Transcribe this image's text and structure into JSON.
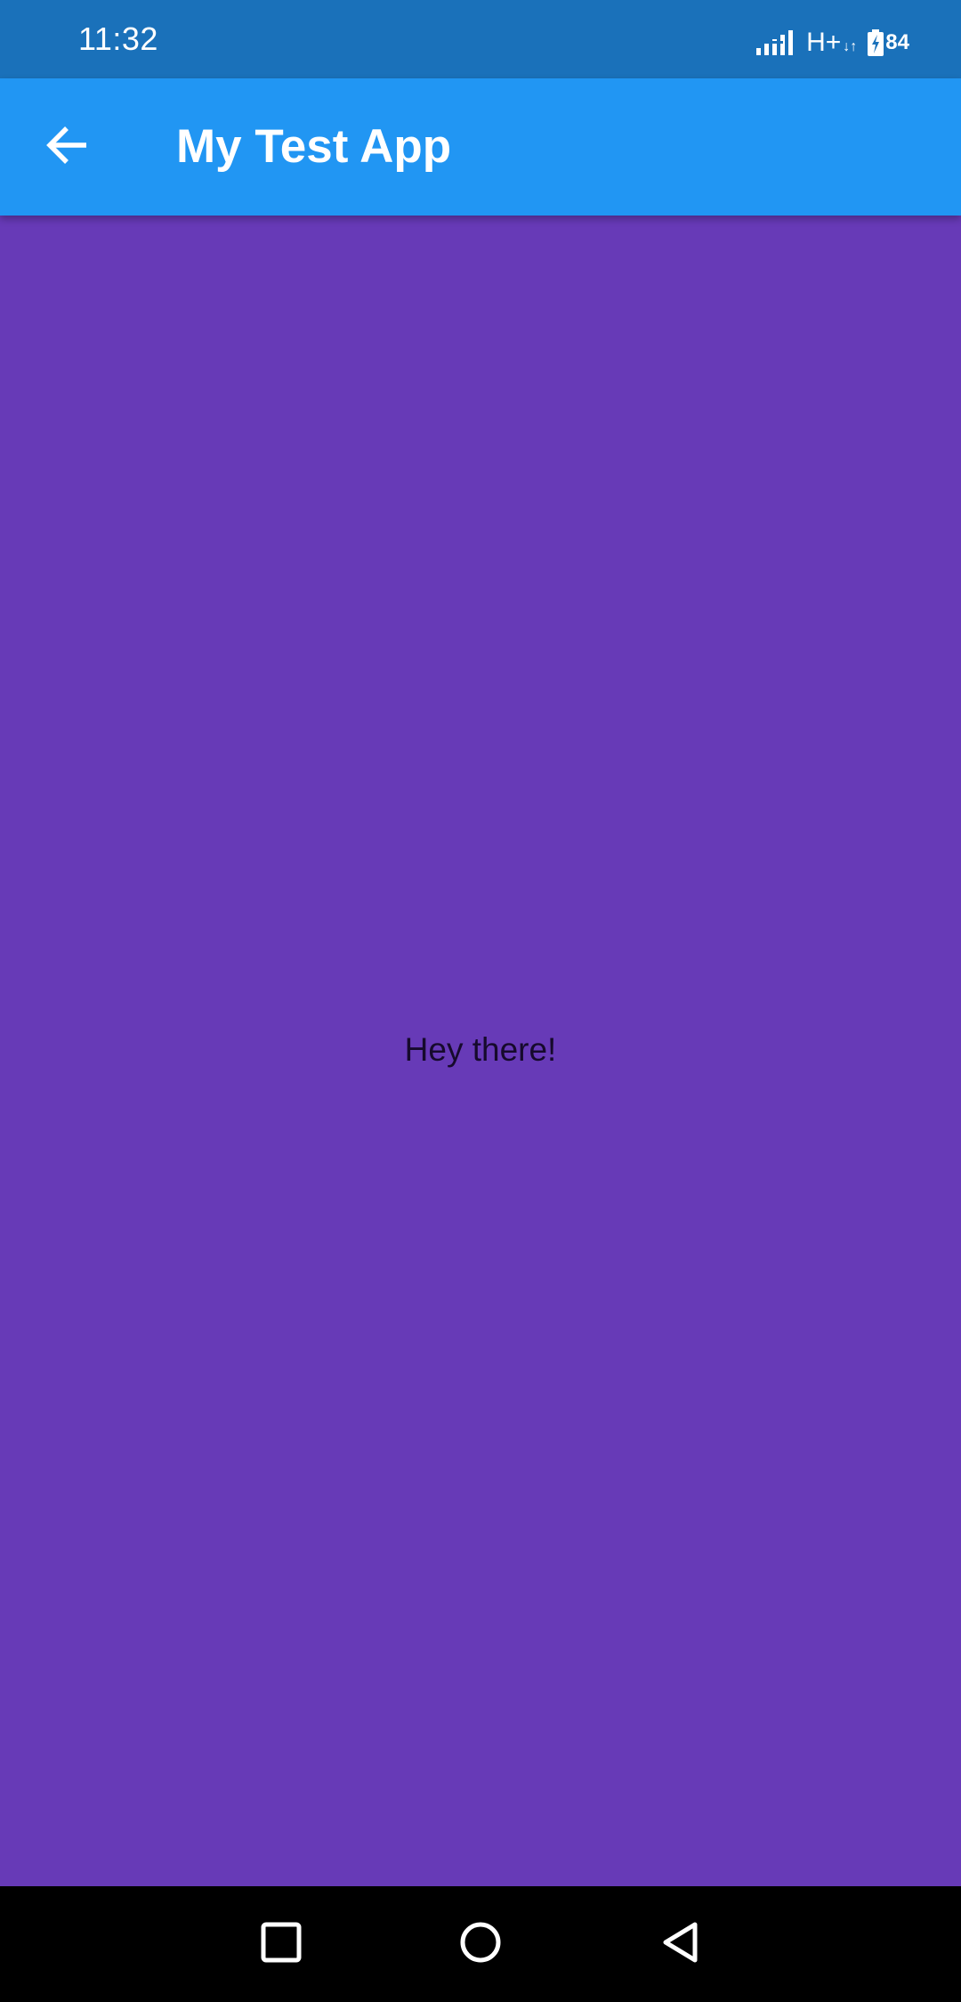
{
  "status_bar": {
    "time": "11:32",
    "network_type": "H+",
    "network_arrows": "↓↑",
    "battery_level": "84",
    "icons": [
      "signal-icon",
      "battery-charging-icon"
    ]
  },
  "app_bar": {
    "title": "My Test App",
    "back_icon": "arrow-back-icon",
    "color": "#2196F3"
  },
  "content": {
    "text": "Hey there!",
    "background_color": "#673AB7"
  },
  "nav_bar": {
    "buttons": [
      "recents-square-icon",
      "home-circle-icon",
      "back-triangle-icon"
    ]
  }
}
